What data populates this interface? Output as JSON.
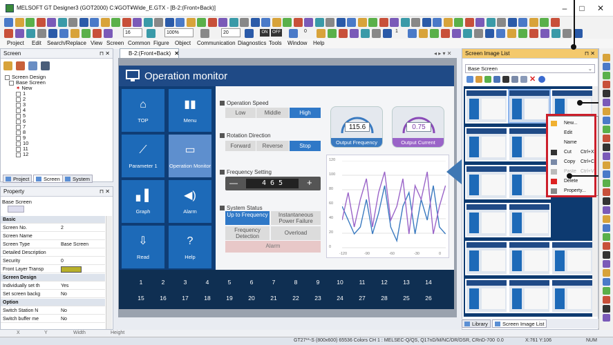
{
  "window": {
    "title": "MELSOFT GT Designer3 (GOT2000) C:¥GOT¥Wide_E.GTX - [B-2:(Front+Back)]",
    "minimize": "–",
    "maximize": "□",
    "close": "✕"
  },
  "toolbar": {
    "font_size": "16",
    "zoom": "100%",
    "grid": "20",
    "on_label": "ON",
    "off_label": "OFF",
    "value0": "0",
    "value1": "1"
  },
  "menu": [
    "Project",
    "Edit",
    "Search/Replace",
    "View",
    "Screen",
    "Common",
    "Figure",
    "Object",
    "Communication",
    "Diagnostics",
    "Tools",
    "Window",
    "Help"
  ],
  "screen_panel": {
    "title": "Screen",
    "tree": {
      "root": "Screen Design",
      "base": "Base Screen",
      "new": "New",
      "items": [
        "1",
        "2",
        "3",
        "4",
        "5",
        "6",
        "7",
        "8",
        "9",
        "10",
        "11",
        "12"
      ]
    },
    "tabs": [
      "Project",
      "Screen",
      "System"
    ]
  },
  "property_panel": {
    "title": "Property",
    "subject": "Base Screen",
    "rows": [
      {
        "k": "Basic",
        "v": "",
        "cat": true
      },
      {
        "k": "Screen No.",
        "v": "2"
      },
      {
        "k": "Screen Name",
        "v": ""
      },
      {
        "k": "Screen Type",
        "v": "Base Screen"
      },
      {
        "k": "Detailed Description",
        "v": ""
      },
      {
        "k": "Security",
        "v": "0"
      },
      {
        "k": "Front Layer Transp",
        "v": ""
      },
      {
        "k": "Screen Design",
        "v": "",
        "cat": true
      },
      {
        "k": "Individually set th",
        "v": "Yes"
      },
      {
        "k": "Set screen backg",
        "v": "No"
      },
      {
        "k": "Option",
        "v": "",
        "cat": true
      },
      {
        "k": "Switch Station N",
        "v": "No"
      },
      {
        "k": "Switch buffer me",
        "v": "No"
      }
    ]
  },
  "doc_tab": {
    "label": "B-2:(Front+Back)",
    "close": "✕"
  },
  "operation_monitor": {
    "title": "Operation monitor",
    "tiles": [
      {
        "label": "TOP"
      },
      {
        "label": "Menu"
      },
      {
        "label": "Parameter 1"
      },
      {
        "label": "Operation Monitor"
      },
      {
        "label": "Graph"
      },
      {
        "label": "Alarm"
      },
      {
        "label": "Read"
      },
      {
        "label": "Help"
      }
    ],
    "speed": {
      "heading": "Operation Speed",
      "options": [
        "Low",
        "Middle",
        "High"
      ],
      "selected": "High"
    },
    "rotation": {
      "heading": "Rotation Direction",
      "options": [
        "Forward",
        "Reverse",
        "Stop"
      ],
      "selected": "Stop"
    },
    "frequency": {
      "heading": "Frequency Setting",
      "value": "4 6 5",
      "minus": "—",
      "plus": "+"
    },
    "status": {
      "heading": "System Status",
      "up": "Up to Frequency",
      "power": "Instantaneous Power Failure",
      "freq_det": "Frequency Detection",
      "overload": "Overload",
      "alarm": "Alarm"
    },
    "gauge1": {
      "label": "Output Frequency",
      "value": "115.6"
    },
    "gauge2": {
      "label": "Output Current",
      "value": "0.75"
    },
    "numbers_row1": [
      "1",
      "2",
      "3",
      "4",
      "5",
      "6",
      "7",
      "8",
      "9",
      "10",
      "11",
      "12",
      "13",
      "14"
    ],
    "numbers_row2": [
      "15",
      "16",
      "17",
      "18",
      "19",
      "20",
      "21",
      "22",
      "23",
      "24",
      "27",
      "28",
      "25",
      "26"
    ],
    "chart_y": [
      "120",
      "100",
      "80",
      "60",
      "40",
      "20",
      "0"
    ],
    "chart_x": [
      "-120",
      "-90",
      "-60",
      "-30",
      "0"
    ]
  },
  "image_list": {
    "title": "Screen Image List",
    "dropdown": "Base Screen",
    "tabs": [
      "Library",
      "Screen Image List"
    ]
  },
  "context_menu": {
    "items": [
      {
        "label": "New...",
        "shortcut": ""
      },
      {
        "label": "Edit",
        "shortcut": ""
      },
      {
        "label": "Name",
        "shortcut": ""
      },
      {
        "label": "Cut",
        "shortcut": "Ctrl+X"
      },
      {
        "label": "Copy",
        "shortcut": "Ctrl+C"
      },
      {
        "label": "Paste",
        "shortcut": "Ctrl+V"
      },
      {
        "label": "Delete",
        "shortcut": ""
      },
      {
        "label": "Property...",
        "shortcut": ""
      }
    ]
  },
  "format_bar": {
    "x": "X",
    "y": "Y",
    "width": "Width",
    "height": "Height"
  },
  "status_bar": {
    "info": "GT27**-S (800x600)  65536 Colors  CH 1 : MELSEC-Q/QS, Q17nD/M/NC/DR/DSR, CRnD-700",
    "pos": "X:761 Y:106",
    "num": "NUM",
    "zero": "0.0"
  }
}
